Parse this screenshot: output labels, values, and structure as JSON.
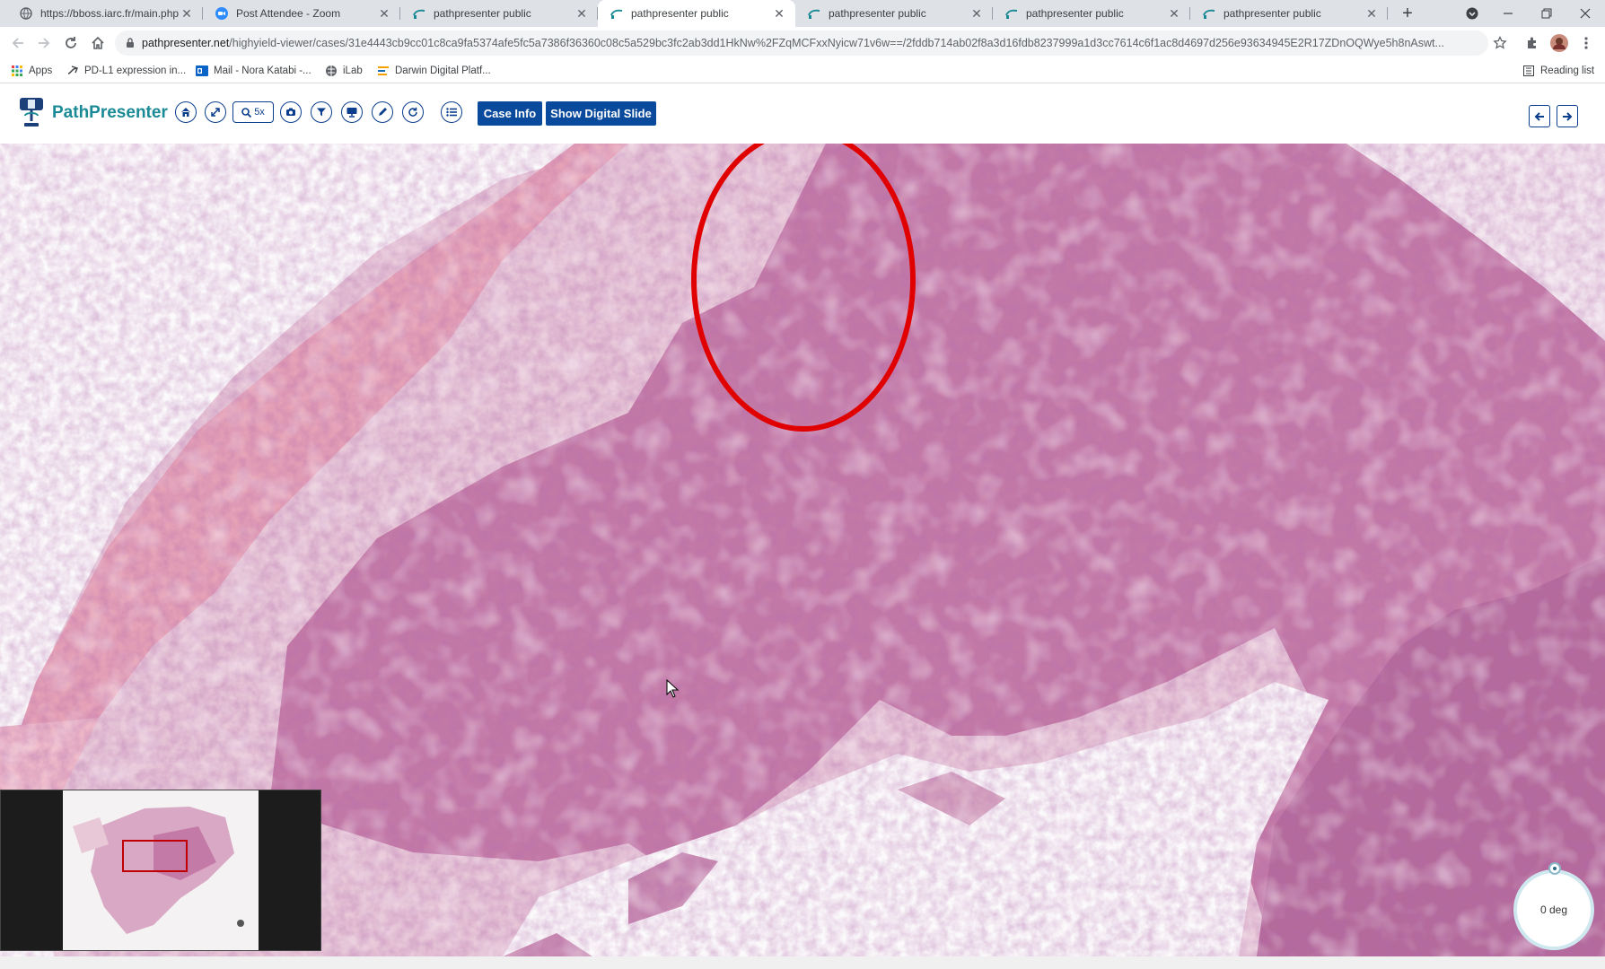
{
  "browser": {
    "tabs": [
      {
        "title": "https://bboss.iarc.fr/main.php",
        "icon": "globe-icon",
        "active": false
      },
      {
        "title": "Post Attendee - Zoom",
        "icon": "zoom-video-icon",
        "active": false
      },
      {
        "title": "pathpresenter public",
        "icon": "pathpresenter-favicon",
        "active": false
      },
      {
        "title": "pathpresenter public",
        "icon": "pathpresenter-favicon",
        "active": true
      },
      {
        "title": "pathpresenter public",
        "icon": "pathpresenter-favicon",
        "active": false
      },
      {
        "title": "pathpresenter public",
        "icon": "pathpresenter-favicon",
        "active": false
      },
      {
        "title": "pathpresenter public",
        "icon": "pathpresenter-favicon",
        "active": false
      }
    ],
    "url_domain": "pathpresenter.net",
    "url_path": "/highyield-viewer/cases/31e4443cb9cc01c8ca9fa5374afe5fc5a7386f36360c08c5a529bc3fc2ab3dd1HkNw%2FZqMCFxxNyicw71v6w==/2fddb714ab02f8a3d16fdb8237999a1d3cc7614c6f1ac8d4697d256e93634945E2R17ZDnOQWye5h8nAswt...",
    "bookmarks": [
      {
        "label": "Apps",
        "icon": "apps-grid-icon"
      },
      {
        "label": "PD-L1 expression in...",
        "icon": "link-icon"
      },
      {
        "label": "Mail - Nora Katabi -...",
        "icon": "outlook-icon"
      },
      {
        "label": "iLab",
        "icon": "globe-icon"
      },
      {
        "label": "Darwin Digital Platf...",
        "icon": "darwin-icon"
      }
    ],
    "reading_list": "Reading list"
  },
  "app": {
    "logo_text": "PathPresenter",
    "zoom_label": "5x",
    "case_info_label": "Case Info",
    "show_slide_label": "Show Digital Slide",
    "toolbar_icons": [
      "home-icon",
      "fullscreen-icon",
      "zoom-icon",
      "camera-icon",
      "filter-icon",
      "monitor-icon",
      "pencil-icon",
      "rotate-icon",
      "list-icon"
    ],
    "rotation_label": "0 deg"
  },
  "colors": {
    "brand_teal": "#1a8a96",
    "button_blue": "#0a4a9c",
    "annotation_red": "#e00000",
    "tissue_pink": "#c47aa6",
    "epithelium_pink": "#e6a2b6"
  }
}
